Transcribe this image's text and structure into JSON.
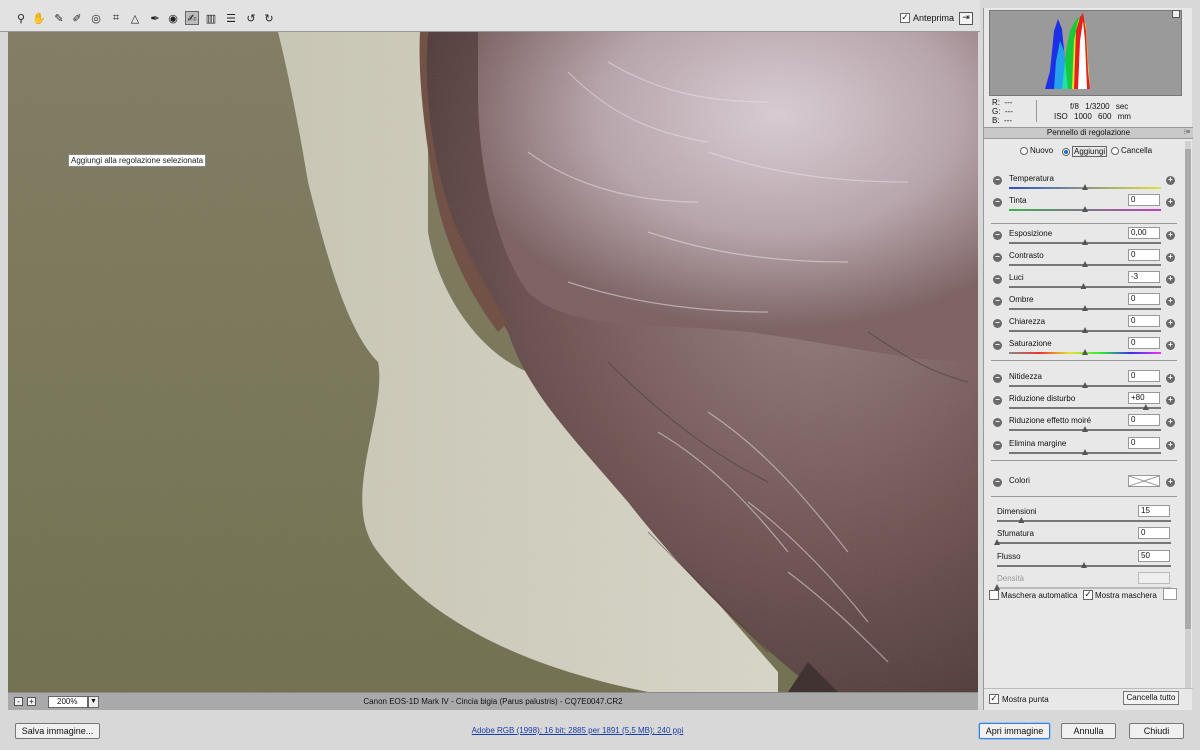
{
  "toolbar": {
    "tools": [
      {
        "name": "zoom-tool",
        "icon": "magnifier-icon",
        "glyph": "⚲"
      },
      {
        "name": "hand-tool",
        "icon": "hand-icon",
        "glyph": "✋"
      },
      {
        "name": "white-balance-tool",
        "icon": "eyedropper-icon",
        "glyph": "✎"
      },
      {
        "name": "color-sampler-tool",
        "icon": "color-sampler-icon",
        "glyph": "✐"
      },
      {
        "name": "targeted-adjustment-tool",
        "icon": "target-icon",
        "glyph": "◎"
      },
      {
        "name": "crop-tool",
        "icon": "crop-icon",
        "glyph": "⌗"
      },
      {
        "name": "straighten-tool",
        "icon": "straighten-icon",
        "glyph": "△"
      },
      {
        "name": "spot-removal-tool",
        "icon": "spot-removal-icon",
        "glyph": "✒"
      },
      {
        "name": "red-eye-tool",
        "icon": "eye-icon",
        "glyph": "◉"
      },
      {
        "name": "adjustment-brush-tool",
        "icon": "brush-icon",
        "glyph": "✍"
      },
      {
        "name": "graduated-filter-tool",
        "icon": "gradient-icon",
        "glyph": "▥"
      },
      {
        "name": "preferences-tool",
        "icon": "list-icon",
        "glyph": "☰"
      },
      {
        "name": "rotate-left-tool",
        "icon": "rotate-ccw-icon",
        "glyph": "↺"
      },
      {
        "name": "rotate-right-tool",
        "icon": "rotate-cw-icon",
        "glyph": "↻"
      }
    ],
    "active_tool": "adjustment-brush-tool",
    "preview_label": "Anteprima",
    "preview_checked": true
  },
  "zoom": {
    "minus": "-",
    "plus": "+",
    "value": "200%"
  },
  "caption": "Canon EOS-1D Mark IV  -  Cincia bigia (Parus palustris)  -  CQ7E0047.CR2",
  "histogram": {
    "r": "---",
    "g": "---",
    "b": "---",
    "aperture": "f/8",
    "shutter": "1/3200 sec",
    "iso": "ISO 1000",
    "focal": "600 mm"
  },
  "panel": {
    "title": "Pennello di regolazione",
    "modes": {
      "new": "Nuovo",
      "add": "Aggiungi",
      "erase": "Cancella",
      "selected": "Aggiungi"
    },
    "tooltip": "Aggiungi alla regolazione selezionata",
    "sliders": [
      {
        "label": "Temperatura",
        "value": "",
        "pos": 0.5,
        "track": "linear-gradient(90deg,#2a4fd0,#e6e03a)"
      },
      {
        "label": "Tinta",
        "value": "0",
        "pos": 0.5,
        "track": "linear-gradient(90deg,#3bb34a,#c23bc2)"
      },
      {
        "label": "Esposizione",
        "value": "0,00",
        "pos": 0.5,
        "track": ""
      },
      {
        "label": "Contrasto",
        "value": "0",
        "pos": 0.5,
        "track": ""
      },
      {
        "label": "Luci",
        "value": "-3",
        "pos": 0.49,
        "track": ""
      },
      {
        "label": "Ombre",
        "value": "0",
        "pos": 0.5,
        "track": ""
      },
      {
        "label": "Chiarezza",
        "value": "0",
        "pos": 0.5,
        "track": ""
      },
      {
        "label": "Saturazione",
        "value": "0",
        "pos": 0.5,
        "track": "linear-gradient(90deg,#888,#e33,#e3e333,#3e3,#33e,#e3e)"
      },
      {
        "label": "Nitidezza",
        "value": "0",
        "pos": 0.5,
        "track": ""
      },
      {
        "label": "Riduzione disturbo",
        "value": "+80",
        "pos": 0.9,
        "track": ""
      },
      {
        "label": "Riduzione effetto moiré",
        "value": "0",
        "pos": 0.5,
        "track": ""
      },
      {
        "label": "Elimina margine",
        "value": "0",
        "pos": 0.5,
        "track": ""
      }
    ],
    "colori_label": "Colori",
    "brush": [
      {
        "label": "Dimensioni",
        "value": "15",
        "pos": 0.14
      },
      {
        "label": "Sfumatura",
        "value": "0",
        "pos": 0.0
      },
      {
        "label": "Flusso",
        "value": "50",
        "pos": 0.5
      },
      {
        "label": "Densità",
        "value": "",
        "pos": 0.0,
        "disabled": true
      }
    ],
    "auto_mask_label": "Maschera automatica",
    "auto_mask_checked": false,
    "show_mask_label": "Mostra maschera",
    "show_mask_checked": true,
    "show_tip_label": "Mostra punta",
    "show_tip_checked": true,
    "clear_all_label": "Cancella tutto"
  },
  "bottom": {
    "save_label": "Salva immagine...",
    "workflow_link": "Adobe RGB (1998); 16 bit; 2885 per 1891 (5,5 MB); 240 ppi",
    "open_label": "Apri immagine",
    "cancel_label": "Annulla",
    "close_label": "Chiudi"
  }
}
